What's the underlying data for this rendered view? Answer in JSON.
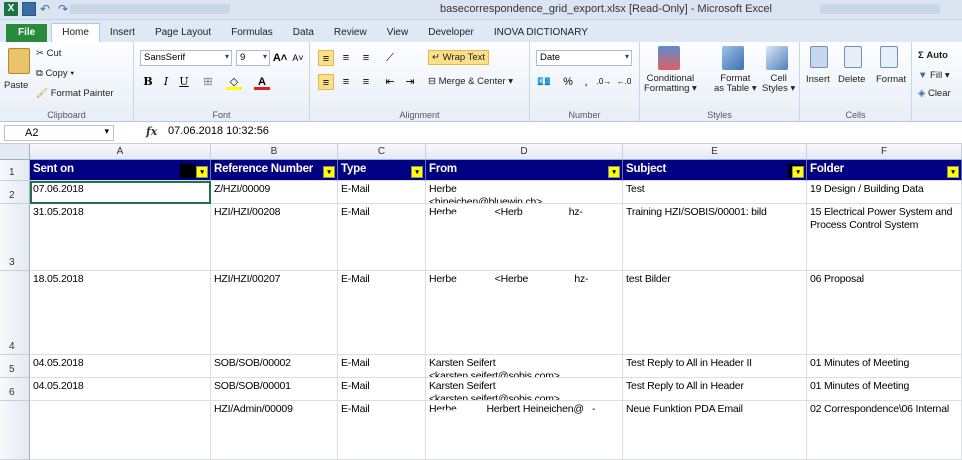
{
  "window": {
    "title": "basecorrespondence_grid_export.xlsx  [Read-Only]  -  Microsoft Excel"
  },
  "ribbon_tabs": [
    "File",
    "Home",
    "Insert",
    "Page Layout",
    "Formulas",
    "Data",
    "Review",
    "View",
    "Developer",
    "INOVA DICTIONARY"
  ],
  "ribbon": {
    "clipboard": {
      "paste": "Paste",
      "cut": "Cut",
      "copy": "Copy ▾",
      "format_painter": "Format Painter",
      "label": "Clipboard"
    },
    "font": {
      "family": "SansSerif",
      "size": "9",
      "label": "Font"
    },
    "alignment": {
      "wrap_text": "Wrap Text",
      "merge_center": "Merge & Center ▾",
      "label": "Alignment"
    },
    "number": {
      "format": "Date",
      "label": "Number"
    },
    "styles": {
      "conditional": "Conditional",
      "conditional2": "Formatting ▾",
      "format": "Format",
      "format2": "as Table ▾",
      "cell": "Cell",
      "cell2": "Styles ▾",
      "label": "Styles"
    },
    "cells": {
      "insert": "Insert",
      "delete": "Delete",
      "format": "Format",
      "label": "Cells"
    },
    "editing": {
      "autosum": "Σ Auto",
      "fill": "Fill ▾",
      "clear": "Clear"
    }
  },
  "formula_bar": {
    "name_box": "A2",
    "fx": "fx",
    "content": "07.06.2018  10:32:56"
  },
  "columns": [
    "A",
    "B",
    "C",
    "D",
    "E",
    "F"
  ],
  "rows": [
    "1",
    "2",
    "3",
    "4",
    "5",
    "6"
  ],
  "headers": [
    "Sent on",
    "Reference Number",
    "Type",
    "From",
    "Subject",
    "Folder"
  ],
  "table": [
    [
      "07.06.2018",
      "Z/HZI/00009",
      "E-Mail",
      "Herbe\n<hineichen@bluewin.ch>",
      "Test",
      "19 Design / Building Data"
    ],
    [
      "31.05.2018",
      "HZI/HZI/00208",
      "E-Mail",
      "Herbe              <Herb                 hz-",
      "Training HZI/SOBIS/00001: bild",
      "15 Electrical Power System and Process Control System"
    ],
    [
      "18.05.2018",
      "HZI/HZI/00207",
      "E-Mail",
      "Herbe              <Herbe                 hz-",
      "test Bilder",
      "06 Proposal"
    ],
    [
      "04.05.2018",
      "SOB/SOB/00002",
      "E-Mail",
      "Karsten Seifert\n<karsten.seifert@sobis.com>",
      "Test Reply to All in Header II",
      "01 Minutes of Meeting"
    ],
    [
      "04.05.2018",
      "SOB/SOB/00001",
      "E-Mail",
      "Karsten Seifert\n<karsten.seifert@sobis.com>",
      "Test Reply to All in Header",
      "01 Minutes of Meeting"
    ],
    [
      "",
      "HZI/Admin/00009",
      "E-Mail",
      "Herbe           Herbert Heineichen@   -",
      "Neue Funktion PDA Email",
      "02 Correspondence\\06 Internal"
    ]
  ]
}
